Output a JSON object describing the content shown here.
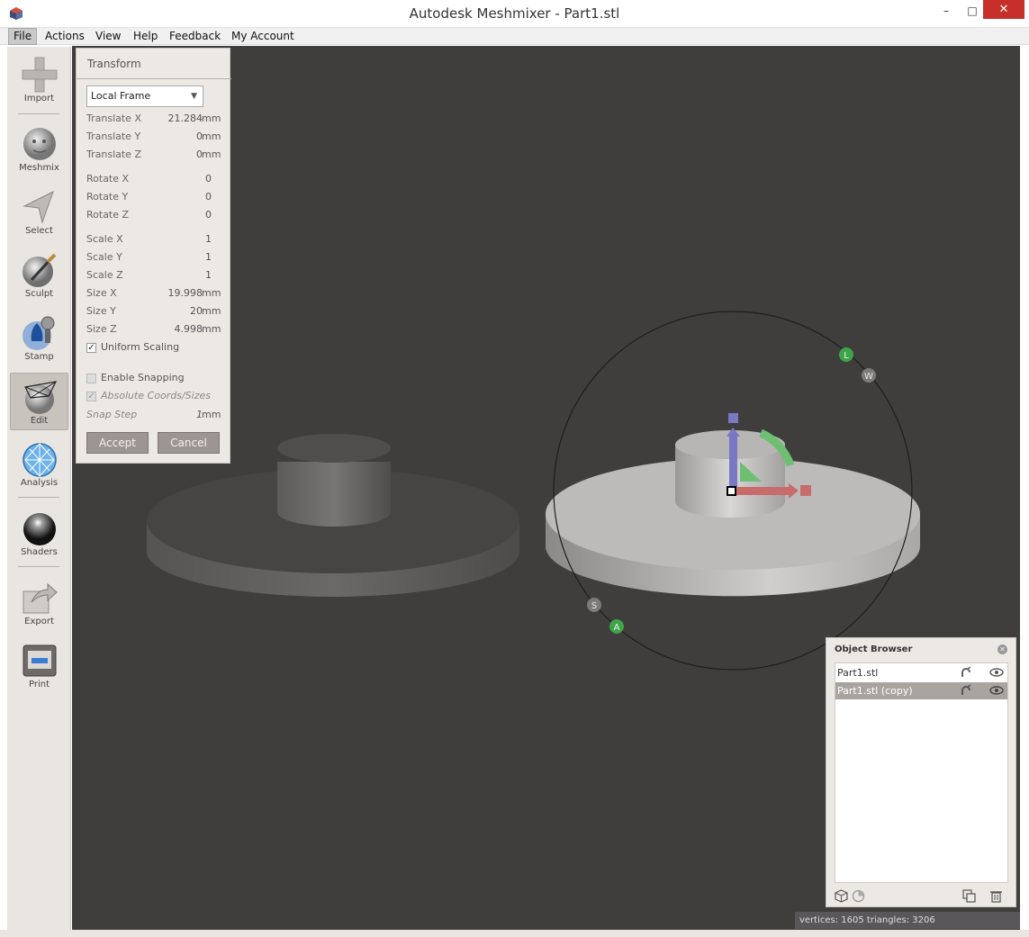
{
  "window": {
    "title": "Autodesk Meshmixer - Part1.stl",
    "min_glyph": "–",
    "max_glyph": "□",
    "close_glyph": "✕"
  },
  "menu": [
    "File",
    "Actions",
    "View",
    "Help",
    "Feedback",
    "My Account"
  ],
  "toolbar": {
    "import": "Import",
    "meshmix": "Meshmix",
    "select": "Select",
    "sculpt": "Sculpt",
    "stamp": "Stamp",
    "edit": "Edit",
    "analysis": "Analysis",
    "shaders": "Shaders",
    "export": "Export",
    "print": "Print"
  },
  "transform": {
    "title": "Transform",
    "frame": "Local Frame",
    "translate_x": {
      "label": "Translate X",
      "value": "21.284",
      "unit": "mm"
    },
    "translate_y": {
      "label": "Translate Y",
      "value": "0",
      "unit": "mm"
    },
    "translate_z": {
      "label": "Translate Z",
      "value": "0",
      "unit": "mm"
    },
    "rotate_x": {
      "label": "Rotate X",
      "value": "0"
    },
    "rotate_y": {
      "label": "Rotate Y",
      "value": "0"
    },
    "rotate_z": {
      "label": "Rotate Z",
      "value": "0"
    },
    "scale_x": {
      "label": "Scale X",
      "value": "1"
    },
    "scale_y": {
      "label": "Scale Y",
      "value": "1"
    },
    "scale_z": {
      "label": "Scale Z",
      "value": "1"
    },
    "size_x": {
      "label": "Size X",
      "value": "19.998",
      "unit": "mm"
    },
    "size_y": {
      "label": "Size Y",
      "value": "20",
      "unit": "mm"
    },
    "size_z": {
      "label": "Size Z",
      "value": "4.998",
      "unit": "mm"
    },
    "uniform_scaling": {
      "label": "Uniform Scaling",
      "checked": true
    },
    "enable_snapping": {
      "label": "Enable Snapping",
      "checked": false
    },
    "absolute_coords": {
      "label": "Absolute Coords/Sizes",
      "checked": true
    },
    "snap_step": {
      "label": "Snap Step",
      "value": "1",
      "unit": "mm"
    },
    "accept": "Accept",
    "cancel": "Cancel"
  },
  "gizmo_labels": {
    "l": "L",
    "w": "W",
    "s": "S",
    "a": "A"
  },
  "object_browser": {
    "title": "Object Browser",
    "objects": [
      {
        "name": "Part1.stl",
        "selected": false
      },
      {
        "name": "Part1.stl (copy)",
        "selected": true
      }
    ]
  },
  "status": "vertices: 1605 triangles: 3206",
  "colors": {
    "viewport_bg": "#3f3e3c",
    "panel_bg": "#ece8e4",
    "close_red": "#c7302a",
    "axis_x": "#c86b6b",
    "axis_y": "#6fbf73",
    "axis_z": "#7a78c4"
  }
}
